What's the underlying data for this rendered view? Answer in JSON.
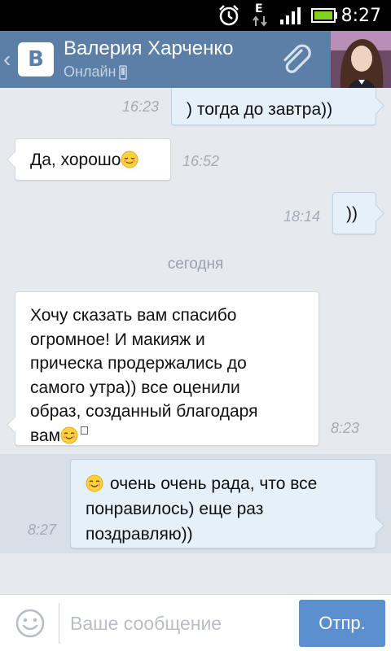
{
  "status_bar": {
    "time": "8:27",
    "network": "E",
    "icons": [
      "alarm-icon",
      "data-arrows-icon",
      "signal-icon",
      "battery-icon"
    ]
  },
  "header": {
    "contact_name": "Валерия Харченко",
    "contact_status": "Онлайн",
    "logo_text": "B",
    "accent_color": "#5b7fa6"
  },
  "messages": [
    {
      "direction": "out",
      "text": ") тогда до завтра))",
      "time": "16:23"
    },
    {
      "direction": "in",
      "text": "Да, хорошо",
      "emoji": "relieved-face",
      "time": "16:52"
    },
    {
      "direction": "out",
      "text": "))",
      "time": "18:14"
    },
    {
      "divider": "сегодня"
    },
    {
      "direction": "in",
      "lines": [
        "Хочу сказать вам спасибо",
        "огромное! И макияж и",
        "прическа продержались до",
        "самого утра)) все оценили",
        "образ, созданный благодаря",
        "вам"
      ],
      "emoji": "smiling-face",
      "time": "8:23"
    },
    {
      "direction": "out",
      "lines": [
        "очень очень рада, что все",
        "понравилось) еще раз",
        "поздравляю))"
      ],
      "emoji": "smiling-face",
      "time": "8:27"
    }
  ],
  "input_bar": {
    "placeholder": "Ваше сообщение",
    "send_label": "Отпр."
  }
}
